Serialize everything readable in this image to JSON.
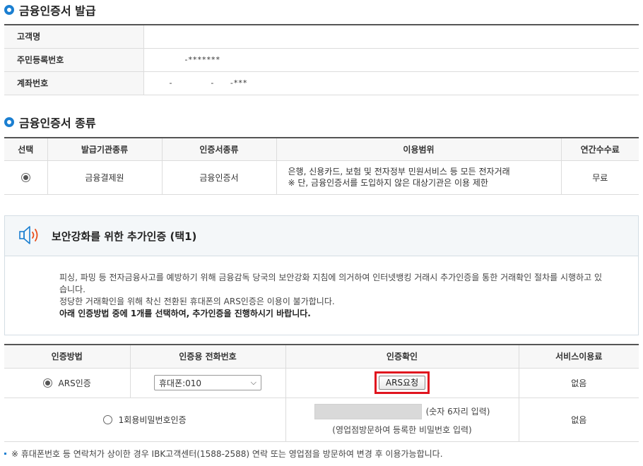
{
  "issue": {
    "title": "금융인증서 발급",
    "rows": [
      {
        "label": "고객명",
        "value": ""
      },
      {
        "label": "주민등록번호",
        "value": "-*******"
      },
      {
        "label": "계좌번호",
        "value": "-            -     -***"
      }
    ]
  },
  "cert_type": {
    "title": "금융인증서 종류",
    "headers": [
      "선택",
      "발급기관종류",
      "인증서종류",
      "이용범위",
      "연간수수료"
    ],
    "row": {
      "issuer": "금융결제원",
      "cert": "금융인증서",
      "scope_line1": "은행, 신용카드, 보험 및 전자정부 민원서비스 등 모든 전자거래",
      "scope_line2": "※ 단, 금융인증서를 도입하지 않은 대상기관은 이용 제한",
      "fee": "무료"
    }
  },
  "security": {
    "title": "보안강화를 위한 추가인증 (택1)",
    "line1": "피싱, 파밍 등 전자금융사고를 예방하기 위해 금융감독 당국의 보안강화 지침에 의거하여 인터넷뱅킹 거래시 추가인증을 통한 거래확인 절차를 시행하고 있",
    "line2": "습니다.",
    "line3": "정당한 거래확인을 위해 착신 전환된 휴대폰의 ARS인증은 이용이 불가합니다.",
    "line4": "아래 인증방법 중에 1개를 선택하여, 추가인증을 진행하시기 바랍니다."
  },
  "auth": {
    "headers": [
      "인증방법",
      "인증용 전화번호",
      "인증확인",
      "서비스이용료"
    ],
    "ars": {
      "label": "ARS인증",
      "phone": "휴대폰:010",
      "button": "ARS요청",
      "fee": "없음"
    },
    "otp": {
      "label": "1회용비밀번호인증",
      "hint": "(숫자 6자리 입력)",
      "note": "(영업점방문하여 등록한 비밀번호 입력)",
      "fee": "없음"
    }
  },
  "footnote": "※ 휴대폰번호 등 연락처가 상이한 경우 IBK고객센터(1588-2588) 연락 또는 영업점을 방문하여 변경 후 이용가능합니다."
}
